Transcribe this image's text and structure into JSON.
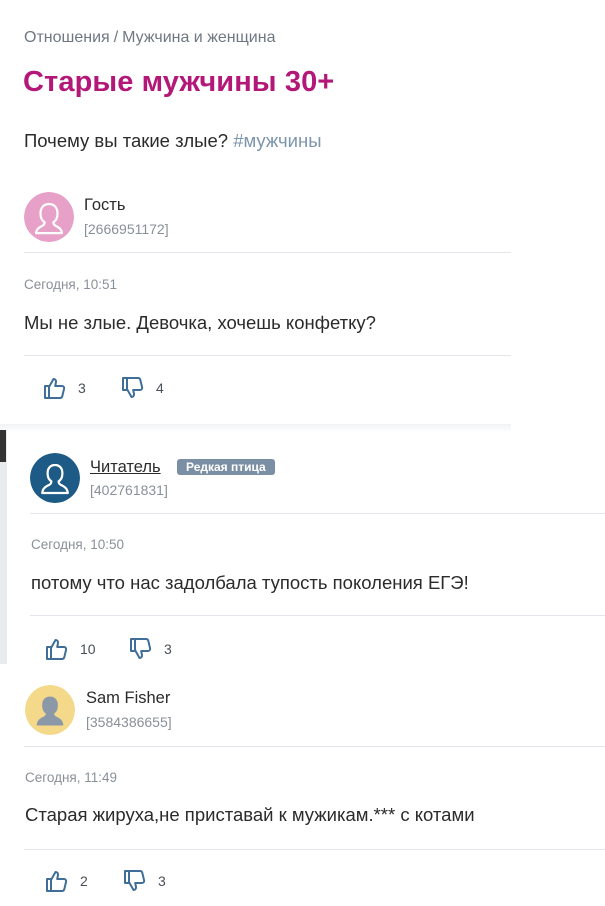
{
  "breadcrumb": {
    "items": [
      "Отношения",
      "Мужчина и женщина"
    ],
    "separator": "/"
  },
  "page_title": "Старые мужчины 30+",
  "question": {
    "text": "Почему вы такие злые?",
    "tag": "#мужчины"
  },
  "colors": {
    "title": "#b31878",
    "tag": "#7c95ac",
    "badge": "#7b8fa4"
  },
  "comments": [
    {
      "author": "Гость",
      "uid": "[2666951172]",
      "avatar_icon": "female-guest-avatar-icon",
      "time": "Сегодня, 10:51",
      "text": "Мы не злые. Девочка, хочешь конфетку?",
      "likes": "3",
      "dislikes": "4"
    },
    {
      "author": "Читатель",
      "badge": "Редкая птица",
      "uid": "[402761831]",
      "avatar_icon": "reader-avatar-icon",
      "time": "Сегодня, 10:50",
      "text": "потому что нас задолбала тупость поколения ЕГЭ!",
      "likes": "10",
      "dislikes": "3"
    },
    {
      "author": "Sam Fisher",
      "uid": "[3584386655]",
      "avatar_icon": "male-guest-avatar-icon",
      "time": "Сегодня, 11:49",
      "text": "Старая жируха,не приставай к мужикам.*** с котами",
      "likes": "2",
      "dislikes": "3"
    }
  ]
}
